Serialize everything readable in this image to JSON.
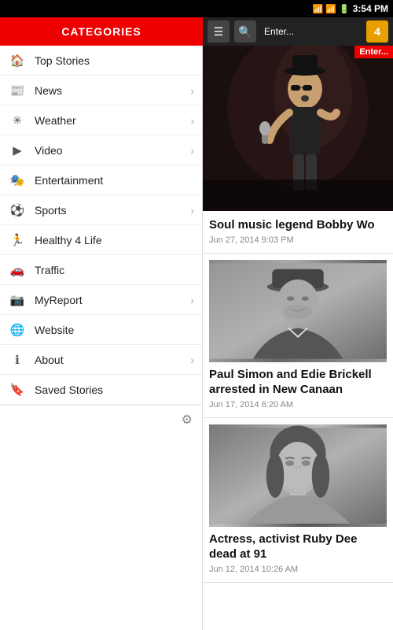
{
  "statusBar": {
    "time": "3:54 PM",
    "battery": "100%"
  },
  "header": {
    "categories_label": "CATEGORIES",
    "hamburger_icon": "☰",
    "search_icon": "🔍",
    "channel_badge": "4"
  },
  "sidebar": {
    "items": [
      {
        "id": "top-stories",
        "label": "Top Stories",
        "icon": "🏠",
        "has_chevron": false
      },
      {
        "id": "news",
        "label": "News",
        "icon": "📰",
        "has_chevron": true
      },
      {
        "id": "weather",
        "label": "Weather",
        "icon": "✳",
        "has_chevron": true
      },
      {
        "id": "video",
        "label": "Video",
        "icon": "▶",
        "has_chevron": true
      },
      {
        "id": "entertainment",
        "label": "Entertainment",
        "icon": "🎭",
        "has_chevron": false
      },
      {
        "id": "sports",
        "label": "Sports",
        "icon": "⚽",
        "has_chevron": true
      },
      {
        "id": "healthy-life",
        "label": "Healthy 4 Life",
        "icon": "🏃",
        "has_chevron": false
      },
      {
        "id": "traffic",
        "label": "Traffic",
        "icon": "🚗",
        "has_chevron": false
      },
      {
        "id": "myreport",
        "label": "MyReport",
        "icon": "📷",
        "has_chevron": true
      },
      {
        "id": "website",
        "label": "Website",
        "icon": "🌐",
        "has_chevron": false
      },
      {
        "id": "about",
        "label": "About",
        "icon": "ℹ",
        "has_chevron": true
      },
      {
        "id": "saved-stories",
        "label": "Saved Stories",
        "icon": "🔖",
        "has_chevron": false
      }
    ],
    "settings_icon": "⚙"
  },
  "main": {
    "top_section_label": "Enter...",
    "articles": [
      {
        "id": "bobby-wo",
        "title": "Soul music legend Bobby Wo",
        "date": "Jun 27, 2014 9:03 PM",
        "has_image": false
      },
      {
        "id": "paul-simon",
        "title": "Paul Simon and Edie Brickell arrested in New Canaan",
        "date": "Jun 17, 2014 6:20 AM",
        "has_image": true,
        "image_type": "paul-simon"
      },
      {
        "id": "ruby-dee",
        "title": "Actress, activist Ruby Dee dead at 91",
        "date": "Jun 12, 2014 10:26 AM",
        "has_image": true,
        "image_type": "ruby-dee"
      }
    ]
  }
}
